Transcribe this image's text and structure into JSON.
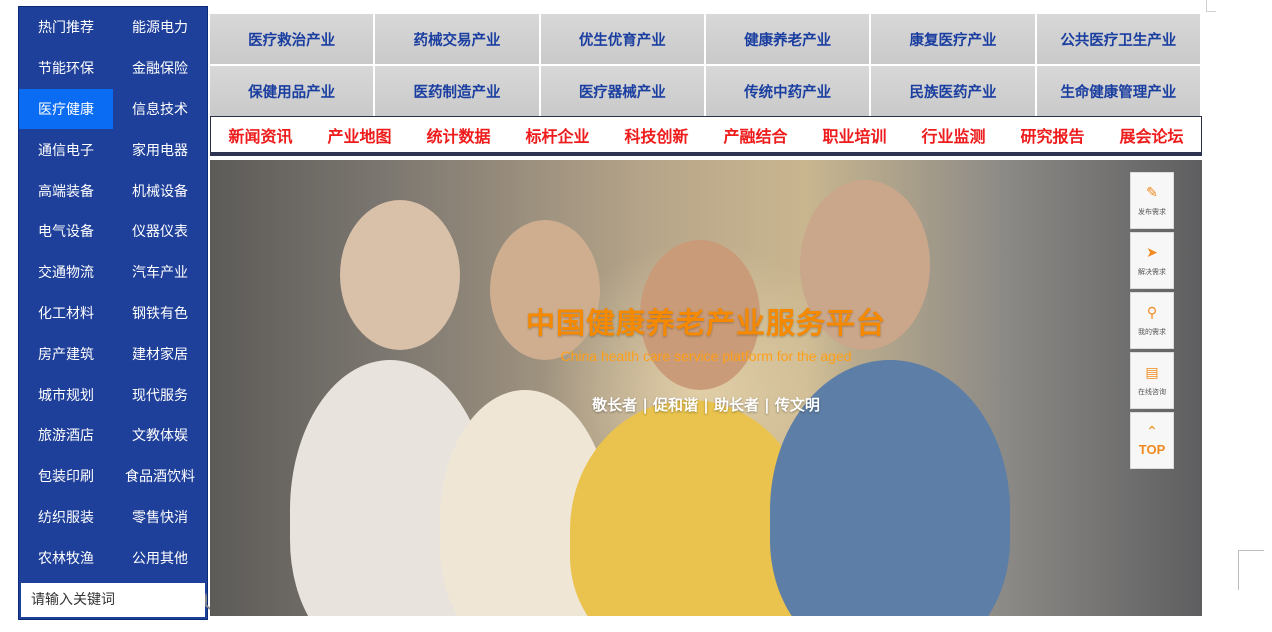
{
  "sidebar": {
    "categories": [
      {
        "label": "热门推荐"
      },
      {
        "label": "能源电力"
      },
      {
        "label": "节能环保"
      },
      {
        "label": "金融保险"
      },
      {
        "label": "医疗健康",
        "active": true
      },
      {
        "label": "信息技术"
      },
      {
        "label": "通信电子"
      },
      {
        "label": "家用电器"
      },
      {
        "label": "高端装备"
      },
      {
        "label": "机械设备"
      },
      {
        "label": "电气设备"
      },
      {
        "label": "仪器仪表"
      },
      {
        "label": "交通物流"
      },
      {
        "label": "汽车产业"
      },
      {
        "label": "化工材料"
      },
      {
        "label": "钢铁有色"
      },
      {
        "label": "房产建筑"
      },
      {
        "label": "建材家居"
      },
      {
        "label": "城市规划"
      },
      {
        "label": "现代服务"
      },
      {
        "label": "旅游酒店"
      },
      {
        "label": "文教体娱"
      },
      {
        "label": "包装印刷"
      },
      {
        "label": "食品酒饮料"
      },
      {
        "label": "纺织服装"
      },
      {
        "label": "零售快消"
      },
      {
        "label": "农林牧渔"
      },
      {
        "label": "公用其他"
      }
    ],
    "search": {
      "placeholder": "请输入关键词",
      "icon": "search-icon"
    }
  },
  "industry_menu": {
    "row1": [
      "医疗救治产业",
      "药械交易产业",
      "优生优育产业",
      "健康养老产业",
      "康复医疗产业",
      "公共医疗卫生产业"
    ],
    "row2": [
      "保健用品产业",
      "医药制造产业",
      "医疗器械产业",
      "传统中药产业",
      "民族医药产业",
      "生命健康管理产业"
    ]
  },
  "nav": [
    "新闻资讯",
    "产业地图",
    "统计数据",
    "标杆企业",
    "科技创新",
    "产融结合",
    "职业培训",
    "行业监测",
    "研究报告",
    "展会论坛"
  ],
  "hero": {
    "title": "中国健康养老产业服务平台",
    "subtitle": "China health care service platform for the aged",
    "slogan": "敬长者 | 促和谐 | 助长者 | 传文明"
  },
  "float_tools": [
    {
      "label": "发布需求",
      "icon": "edit-icon"
    },
    {
      "label": "解决需求",
      "icon": "send-icon"
    },
    {
      "label": "我的需求",
      "icon": "search-list-icon"
    },
    {
      "label": "在线咨询",
      "icon": "chat-icon"
    },
    {
      "label": "TOP",
      "icon": "chevron-up-icon"
    }
  ],
  "colors": {
    "sidebar_bg": "#1e3f9a",
    "sidebar_active": "#0a6cf2",
    "industry_text": "#1b3fa0",
    "nav_text": "#ee1c1c",
    "hero_title": "#f58a00",
    "tool_accent": "#f08a1e"
  }
}
